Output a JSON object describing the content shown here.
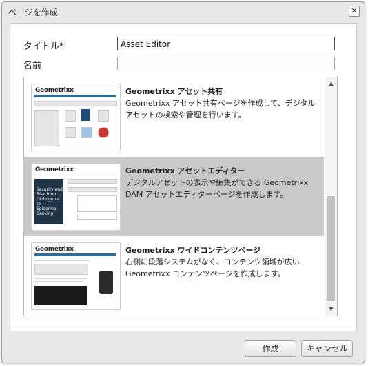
{
  "dialog": {
    "title": "ページを作成",
    "close_label": "✕"
  },
  "form": {
    "title_label": "タイトル*",
    "title_value": "Asset Editor",
    "name_label": "名前",
    "name_value": ""
  },
  "templates": [
    {
      "title": "Geometrixx アセット共有",
      "desc_1": "Geometrixx アセット共有ページを作成して、デジタルアセットの検索や管理を行います。",
      "selected": false
    },
    {
      "title": "Geometrixx アセットエディター",
      "desc_1": "デジタルアセットの表示や編集ができる Geometrixx DAM アセットエディターページを作成します。",
      "selected": true
    },
    {
      "title": "Geometrixx ワイドコンテンツページ",
      "desc_1": "右側に段落システムがなく、コンテンツ領域が広い Geometrixx コンテンツページを作成します。",
      "selected": false
    }
  ],
  "thumb_logo": "Geometrixx",
  "thumb_banner": "Security and Risk from Orthogonal to Epidermal Banking",
  "buttons": {
    "create": "作成",
    "cancel": "キャンセル"
  },
  "colors": {
    "selected_bg": "#c9c9c9",
    "dialog_bg": "#e8e8e8",
    "nav_blue": "#2e6c9a"
  }
}
